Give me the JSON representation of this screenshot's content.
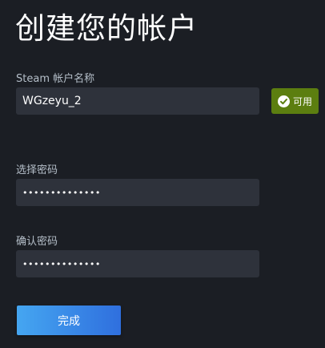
{
  "page": {
    "title": "创建您的帐户"
  },
  "account_name": {
    "label": "Steam 帐户名称",
    "value": "WGzeyu_2",
    "status": "可用",
    "status_color": "#5c7e10"
  },
  "password": {
    "label": "选择密码",
    "value": "••••••••••••••"
  },
  "confirm_password": {
    "label": "确认密码",
    "value": "••••••••••••••"
  },
  "actions": {
    "done_label": "完成"
  },
  "colors": {
    "background": "#1b1e24",
    "input_bg": "#2e323b",
    "accent_start": "#45a6f1",
    "accent_end": "#2f6fde"
  }
}
